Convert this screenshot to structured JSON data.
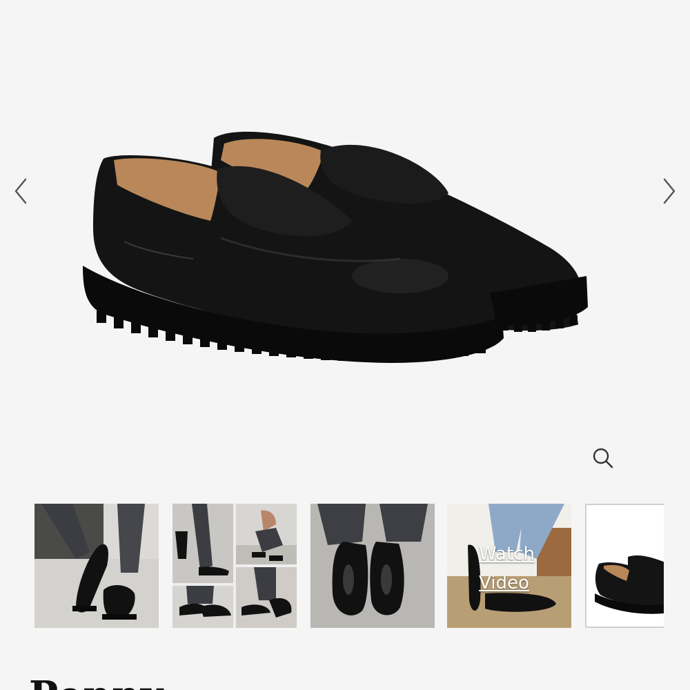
{
  "gallery": {
    "prev_icon": "chevron-left-icon",
    "next_icon": "chevron-right-icon",
    "zoom_icon": "magnifier-icon",
    "hero_alt": "black penny loafers with lug sole"
  },
  "thumbnails": [
    {
      "name": "thumb-lifestyle-street",
      "selected": false
    },
    {
      "name": "thumb-lifestyle-collage",
      "selected": false
    },
    {
      "name": "thumb-lifestyle-topdown",
      "selected": false
    },
    {
      "name": "thumb-video",
      "selected": false,
      "label": "Watch Video"
    },
    {
      "name": "thumb-product",
      "selected": true
    }
  ],
  "product": {
    "title": "Penny"
  },
  "colors": {
    "background": "#f5f5f5",
    "icon": "#555555",
    "shoe": "#0f0f0f",
    "lining": "#b9875a"
  }
}
